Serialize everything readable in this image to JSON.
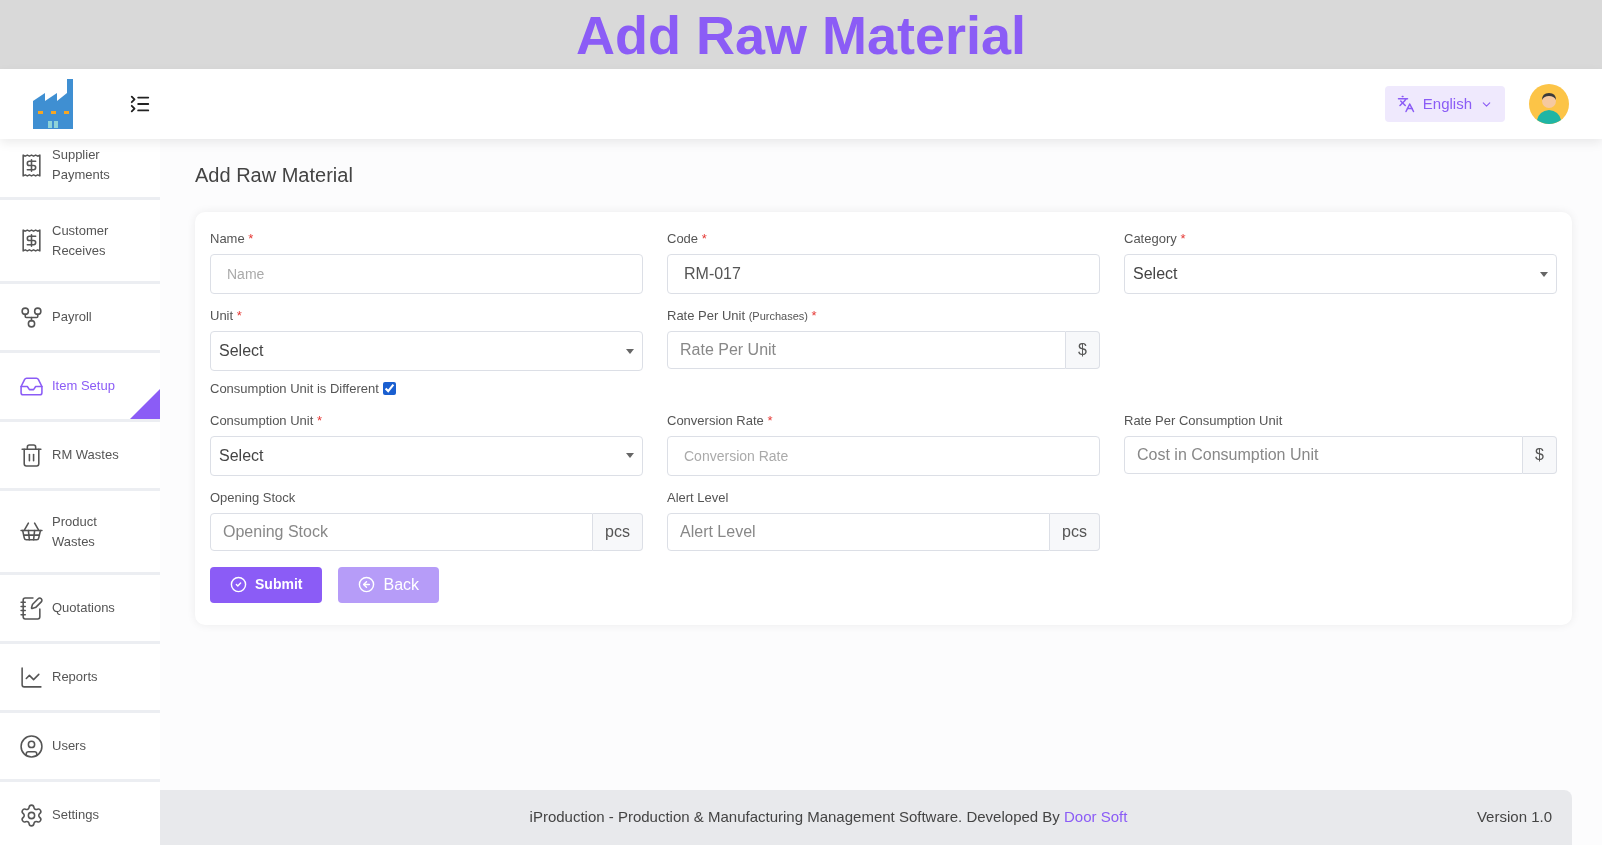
{
  "banner": {
    "title": "Add Raw Material"
  },
  "header": {
    "language": "English"
  },
  "sidebar": {
    "items": [
      {
        "label": "Supplier Payments",
        "selected": false
      },
      {
        "label": "Customer Receives",
        "selected": false
      },
      {
        "label": "Payroll",
        "selected": false
      },
      {
        "label": "Item Setup",
        "selected": true
      },
      {
        "label": "RM Wastes",
        "selected": false
      },
      {
        "label": "Product Wastes",
        "selected": false
      },
      {
        "label": "Quotations",
        "selected": false
      },
      {
        "label": "Reports",
        "selected": false
      },
      {
        "label": "Users",
        "selected": false
      },
      {
        "label": "Settings",
        "selected": false
      }
    ]
  },
  "page": {
    "title": "Add Raw Material"
  },
  "form": {
    "rows": [
      [
        {
          "kind": "text",
          "label": "Name",
          "mark": "*",
          "placeholder": "Name"
        },
        {
          "kind": "text",
          "label": "Code",
          "mark": "*",
          "value": "RM-017"
        },
        {
          "kind": "select",
          "label": "Category",
          "mark": "*",
          "value": "Select"
        }
      ],
      [
        {
          "kind": "select",
          "label": "Unit",
          "mark": "*",
          "value": "Select"
        },
        {
          "kind": "addon",
          "label": "Rate Per Unit",
          "note": "(Purchases)",
          "mark": "*",
          "placeholder": "Rate Per Unit",
          "addon": "$"
        }
      ],
      [
        {
          "kind": "checkbox",
          "label": "Consumption Unit is Different",
          "checked": true
        }
      ],
      [
        {
          "kind": "select",
          "label": "Consumption Unit",
          "mark": "*",
          "value": "Select"
        },
        {
          "kind": "text",
          "label": "Conversion Rate",
          "mark": "*",
          "placeholder": "Conversion Rate"
        },
        {
          "kind": "addon",
          "label": "Rate Per Consumption Unit",
          "placeholder": "Cost in Consumption Unit",
          "addon": "$"
        }
      ],
      [
        {
          "kind": "addon",
          "label": "Opening Stock",
          "placeholder": "Opening Stock",
          "addon": "pcs"
        },
        {
          "kind": "addon",
          "label": "Alert Level",
          "placeholder": "Alert Level",
          "addon": "pcs"
        }
      ]
    ],
    "buttons": [
      {
        "label": "Submit",
        "kind": "primary"
      },
      {
        "label": "Back",
        "kind": "secondary"
      }
    ]
  },
  "footer": {
    "text": "iProduction - Production & Manufacturing Management Software. Developed By",
    "link": "Door Soft",
    "version": "Version 1.0"
  }
}
